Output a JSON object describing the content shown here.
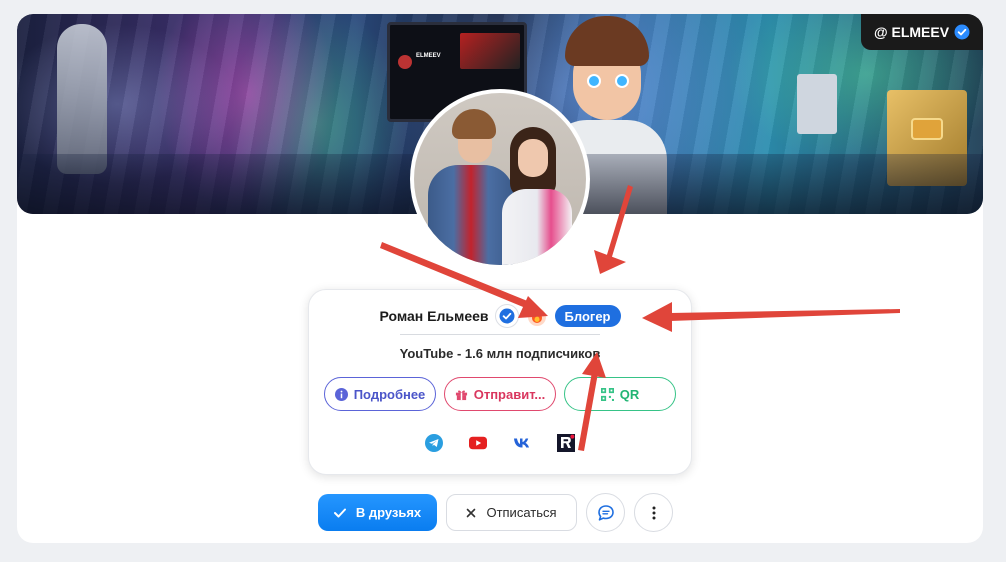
{
  "handle": {
    "text": "@ ELMEEV"
  },
  "banner": {
    "channel_name": "ELMEEV"
  },
  "profile": {
    "name": "Роман Ельмеев",
    "role_badge": "Блогер",
    "subline": "YouTube - 1.6 млн подписчиков"
  },
  "card_buttons": {
    "more_label": "Подробнее",
    "send_label": "Отправит...",
    "qr_label": "QR"
  },
  "socials": [
    "telegram-icon",
    "youtube-icon",
    "vk-icon",
    "rutube-icon"
  ],
  "actions": {
    "friends_label": "В друзьях",
    "unsubscribe_label": "Отписаться"
  },
  "colors": {
    "accent_blue": "#1f6fe0",
    "more_blue": "#4b55c9",
    "send_pink": "#d9365e",
    "qr_green": "#22b574",
    "arrow_red": "#e0453a"
  }
}
